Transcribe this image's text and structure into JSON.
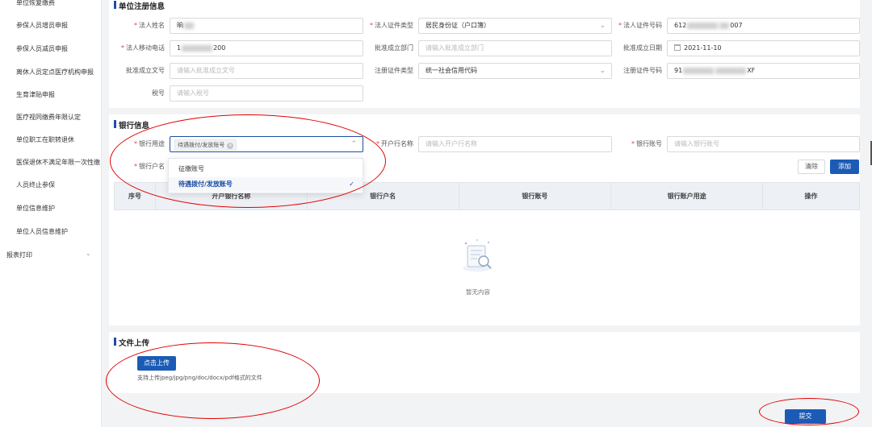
{
  "sidebar": {
    "items": [
      {
        "label": "单位恢复缴费"
      },
      {
        "label": "参保人员增员申报"
      },
      {
        "label": "参保人员减员申报"
      },
      {
        "label": "离休人员定点医疗机构申报"
      },
      {
        "label": "生育津贴申报"
      },
      {
        "label": "医疗视同缴费年限认定"
      },
      {
        "label": "单位职工在职转退休"
      },
      {
        "label": "医保退休不满足年限一次性缴"
      },
      {
        "label": "人员终止参保"
      },
      {
        "label": "单位信息维护"
      },
      {
        "label": "单位人员信息维护"
      }
    ],
    "group": {
      "label": "报表打印"
    }
  },
  "registration": {
    "title": "单位注册信息",
    "legal_name_label": "法人姓名",
    "legal_name_value": "晌",
    "id_type_label": "法人证件类型",
    "id_type_value": "居民身份证（户口簿）",
    "id_no_label": "法人证件号码",
    "id_no_prefix": "612",
    "id_no_suffix": "007",
    "mobile_label": "法人移动电话",
    "mobile_prefix": "1",
    "mobile_suffix": "200",
    "approve_dept_label": "批准成立部门",
    "approve_dept_placeholder": "请输入批准成立部门",
    "approve_date_label": "批准成立日期",
    "approve_date_value": "2021-11-10",
    "approve_doc_label": "批准成立文号",
    "approve_doc_placeholder": "请输入批准成立文号",
    "reg_type_label": "注册证件类型",
    "reg_type_value": "统一社会信用代码",
    "reg_no_label": "注册证件号码",
    "reg_no_prefix": "91",
    "reg_no_suffix": "XF",
    "tax_label": "税号",
    "tax_placeholder": "请输入税号"
  },
  "bank": {
    "title": "银行信息",
    "usage_label": "银行用途",
    "usage_tag": "待遇拨付/发放账号",
    "open_bank_label": "开户行名称",
    "open_bank_placeholder": "请输入开户行名称",
    "account_label": "银行账号",
    "account_placeholder": "请输入银行账号",
    "holder_label": "银行户名",
    "dropdown_options": [
      {
        "label": "征缴账号",
        "selected": false
      },
      {
        "label": "待遇拨付/发放账号",
        "selected": true
      }
    ],
    "clear_button": "清除",
    "add_button": "添加",
    "table_headers": [
      "序号",
      "开户银行名称",
      "银行户名",
      "银行账号",
      "银行账户用途",
      "操作"
    ],
    "empty_text": "暂无内容"
  },
  "upload": {
    "title": "文件上传",
    "button": "点击上传",
    "hint": "支持上传jpeg/jpg/png/doc/docx/pdf格式的文件"
  },
  "submit_button": "提交",
  "colors": {
    "primary": "#1c5bb5",
    "annotation": "#e10000",
    "required": "#e53e3e"
  }
}
